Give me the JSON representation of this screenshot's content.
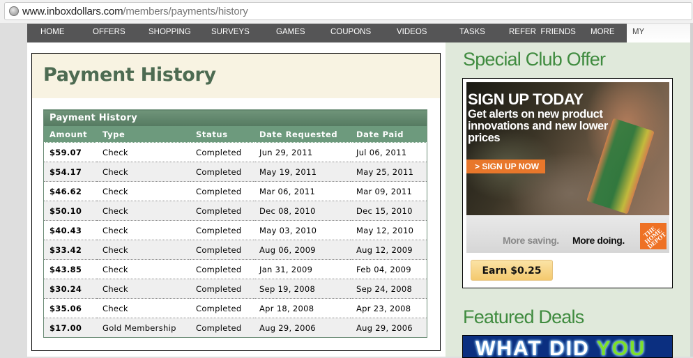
{
  "browser": {
    "url_host": "www.inboxdollars.com",
    "url_path": "/members/payments/history"
  },
  "nav": {
    "items": [
      {
        "label": "HOME"
      },
      {
        "label": "OFFERS"
      },
      {
        "label": "SHOPPING"
      },
      {
        "label": "SURVEYS"
      },
      {
        "label": "GAMES"
      },
      {
        "label": "COUPONS"
      },
      {
        "label": "VIDEOS"
      },
      {
        "label": "TASKS"
      },
      {
        "label": "REFER  FRIENDS"
      },
      {
        "label": "MORE"
      },
      {
        "label": "MY ACCOUNT",
        "active": true
      }
    ]
  },
  "main": {
    "page_title": "Payment History",
    "table": {
      "caption": "Payment History",
      "columns": [
        "Amount",
        "Type",
        "Status",
        "Date Requested",
        "Date Paid"
      ],
      "rows": [
        {
          "amount": "$59.07",
          "type": "Check",
          "status": "Completed",
          "date_requested": "Jun 29, 2011",
          "date_paid": "Jul 06, 2011"
        },
        {
          "amount": "$54.17",
          "type": "Check",
          "status": "Completed",
          "date_requested": "May 19, 2011",
          "date_paid": "May 25, 2011"
        },
        {
          "amount": "$46.62",
          "type": "Check",
          "status": "Completed",
          "date_requested": "Mar 06, 2011",
          "date_paid": "Mar 09, 2011"
        },
        {
          "amount": "$50.10",
          "type": "Check",
          "status": "Completed",
          "date_requested": "Dec 08, 2010",
          "date_paid": "Dec 15, 2010"
        },
        {
          "amount": "$40.43",
          "type": "Check",
          "status": "Completed",
          "date_requested": "May 03, 2010",
          "date_paid": "May 12, 2010"
        },
        {
          "amount": "$33.42",
          "type": "Check",
          "status": "Completed",
          "date_requested": "Aug 06, 2009",
          "date_paid": "Aug 12, 2009"
        },
        {
          "amount": "$43.85",
          "type": "Check",
          "status": "Completed",
          "date_requested": "Jan 31, 2009",
          "date_paid": "Feb 04, 2009"
        },
        {
          "amount": "$30.24",
          "type": "Check",
          "status": "Completed",
          "date_requested": "Sep 19, 2008",
          "date_paid": "Sep 24, 2008"
        },
        {
          "amount": "$35.06",
          "type": "Check",
          "status": "Completed",
          "date_requested": "Apr 18, 2008",
          "date_paid": "Apr 23, 2008"
        },
        {
          "amount": "$17.00",
          "type": "Gold Membership",
          "status": "Completed",
          "date_requested": "Aug 29, 2006",
          "date_paid": "Aug 29, 2006"
        }
      ]
    }
  },
  "sidebar": {
    "offer_heading": "Special Club Offer",
    "ad": {
      "headline": "SIGN UP TODAY",
      "subhead": "Get alerts on new product innovations and new lower prices",
      "cta": "> SIGN UP NOW",
      "tagline_part1": "More saving.",
      "tagline_part2": "More doing.",
      "brand_logo": "THE HOME DEPOT"
    },
    "earn_button": "Earn $0.25",
    "deals_heading": "Featured Deals",
    "deal_banner_text_a": "WHAT DID ",
    "deal_banner_text_b": "YOU"
  },
  "colors": {
    "nav_bg": "#555556",
    "title_green": "#4d6b52",
    "table_header_green": "#6d9a7d",
    "sidebar_bg": "#e0e9db",
    "sidebar_heading_green": "#3f8b3f",
    "title_box_bg": "#f8f3e2"
  }
}
